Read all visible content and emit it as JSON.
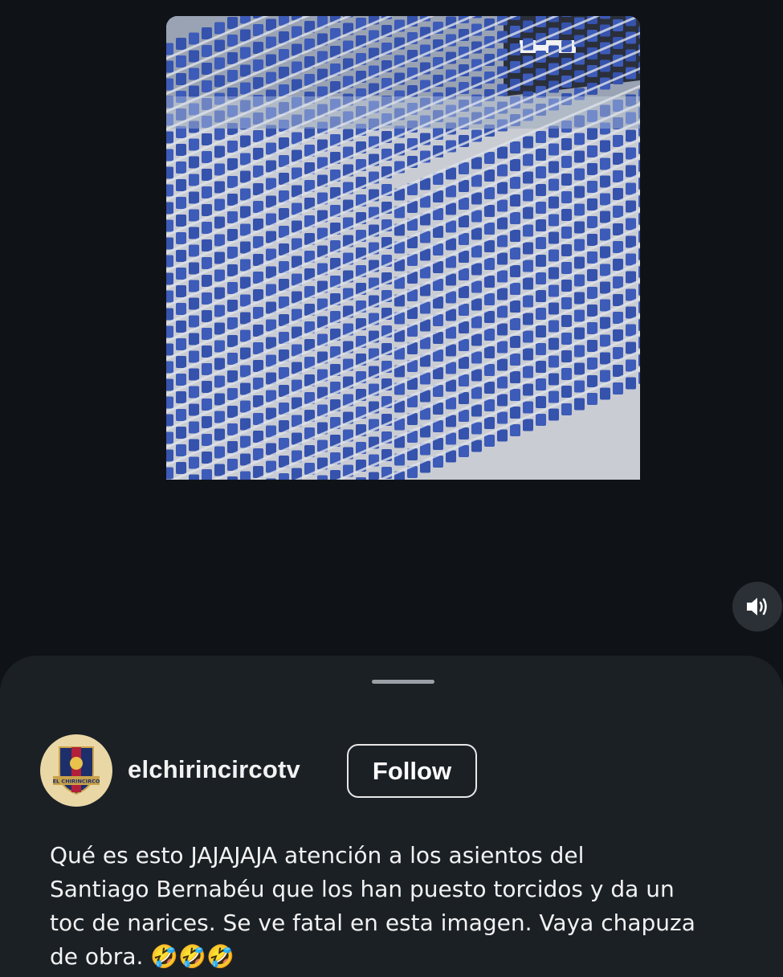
{
  "video": {
    "description_alt": "",
    "sign_left": "← ⬜",
    "sign_right": "🚶 ↑↑"
  },
  "mute_button": {
    "icon": "speaker-volume-icon"
  },
  "post": {
    "username": "elchirincircotv",
    "follow_label": "Follow",
    "avatar_text": "EL CHIRINCIRCO",
    "caption": "Qué es esto JAJAJAJA atención a los asientos del\nSantiago Bernabéu que los han puesto torcidos y da un\ntoc de narices. Se ve fatal en esta imagen. Vaya chapuza\nde obra. 🤣🤣🤣"
  },
  "colors": {
    "background": "#0f1317",
    "sheet": "#1b2025",
    "seat": "#3d5bb8",
    "avatar_bg": "#ead7a6"
  }
}
